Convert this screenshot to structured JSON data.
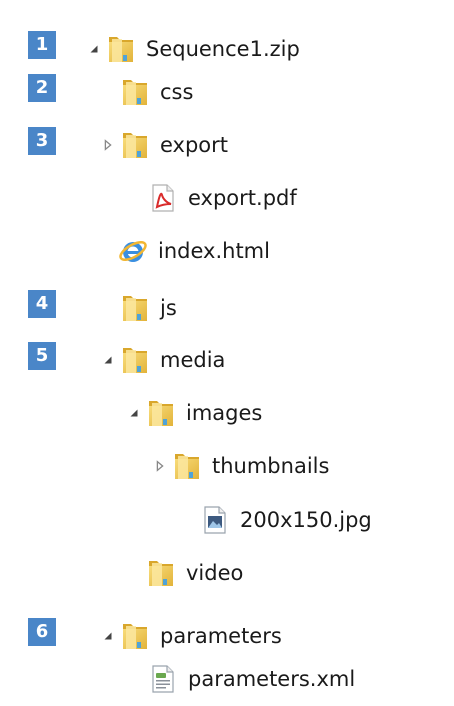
{
  "tree": {
    "badges": [
      "1",
      "2",
      "3",
      "4",
      "5",
      "6"
    ],
    "items": [
      {
        "label": "Sequence1.zip",
        "icon": "folder-icon",
        "expander": "expanded"
      },
      {
        "label": "css",
        "icon": "folder-icon",
        "expander": "none"
      },
      {
        "label": "export",
        "icon": "folder-icon",
        "expander": "collapsed"
      },
      {
        "label": "export.pdf",
        "icon": "pdf-file-icon",
        "expander": "none"
      },
      {
        "label": "index.html",
        "icon": "internet-explorer-icon",
        "expander": "none"
      },
      {
        "label": "js",
        "icon": "folder-icon",
        "expander": "none"
      },
      {
        "label": "media",
        "icon": "folder-icon",
        "expander": "expanded"
      },
      {
        "label": "images",
        "icon": "folder-icon",
        "expander": "expanded"
      },
      {
        "label": "thumbnails",
        "icon": "folder-icon",
        "expander": "collapsed"
      },
      {
        "label": "200x150.jpg",
        "icon": "image-file-icon",
        "expander": "none"
      },
      {
        "label": "video",
        "icon": "folder-icon",
        "expander": "none"
      },
      {
        "label": "parameters",
        "icon": "folder-icon",
        "expander": "expanded"
      },
      {
        "label": "parameters.xml",
        "icon": "xml-file-icon",
        "expander": "none"
      }
    ]
  },
  "colors": {
    "badge": "#4a86c8",
    "folder": "#f2c94c",
    "text": "#1a1a1a"
  }
}
